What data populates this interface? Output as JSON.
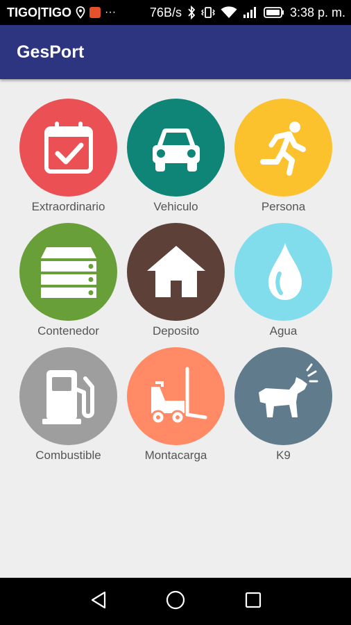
{
  "status_bar": {
    "carrier": "TIGO|TIGO",
    "speed": "76B/s",
    "time": "3:38 p. m.",
    "overflow": "···"
  },
  "app_bar": {
    "title": "GesPort"
  },
  "tiles": [
    {
      "label": "Extraordinario",
      "icon": "calendar-check-icon",
      "color": "#ea5054"
    },
    {
      "label": "Vehiculo",
      "icon": "car-icon",
      "color": "#0e8577"
    },
    {
      "label": "Persona",
      "icon": "running-person-icon",
      "color": "#fbc22e"
    },
    {
      "label": "Contenedor",
      "icon": "container-stack-icon",
      "color": "#689f38"
    },
    {
      "label": "Deposito",
      "icon": "house-icon",
      "color": "#5d4037"
    },
    {
      "label": "Agua",
      "icon": "water-drop-icon",
      "color": "#81dcec"
    },
    {
      "label": "Combustible",
      "icon": "fuel-pump-icon",
      "color": "#9e9e9e"
    },
    {
      "label": "Montacarga",
      "icon": "forklift-icon",
      "color": "#ff8a65"
    },
    {
      "label": "K9",
      "icon": "dog-icon",
      "color": "#5f7b8c"
    }
  ],
  "nav_bar": {
    "back_icon": "back-triangle-icon",
    "home_icon": "home-circle-icon",
    "recents_icon": "recents-square-icon"
  }
}
